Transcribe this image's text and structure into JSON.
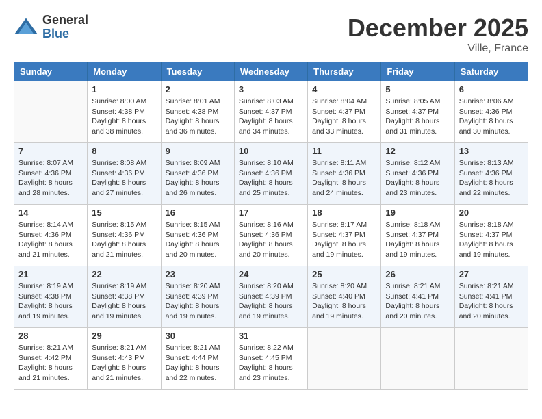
{
  "header": {
    "logo_general": "General",
    "logo_blue": "Blue",
    "month": "December 2025",
    "location": "Ville, France"
  },
  "days_of_week": [
    "Sunday",
    "Monday",
    "Tuesday",
    "Wednesday",
    "Thursday",
    "Friday",
    "Saturday"
  ],
  "weeks": [
    [
      {
        "day": "",
        "info": ""
      },
      {
        "day": "1",
        "info": "Sunrise: 8:00 AM\nSunset: 4:38 PM\nDaylight: 8 hours\nand 38 minutes."
      },
      {
        "day": "2",
        "info": "Sunrise: 8:01 AM\nSunset: 4:38 PM\nDaylight: 8 hours\nand 36 minutes."
      },
      {
        "day": "3",
        "info": "Sunrise: 8:03 AM\nSunset: 4:37 PM\nDaylight: 8 hours\nand 34 minutes."
      },
      {
        "day": "4",
        "info": "Sunrise: 8:04 AM\nSunset: 4:37 PM\nDaylight: 8 hours\nand 33 minutes."
      },
      {
        "day": "5",
        "info": "Sunrise: 8:05 AM\nSunset: 4:37 PM\nDaylight: 8 hours\nand 31 minutes."
      },
      {
        "day": "6",
        "info": "Sunrise: 8:06 AM\nSunset: 4:36 PM\nDaylight: 8 hours\nand 30 minutes."
      }
    ],
    [
      {
        "day": "7",
        "info": "Sunrise: 8:07 AM\nSunset: 4:36 PM\nDaylight: 8 hours\nand 28 minutes."
      },
      {
        "day": "8",
        "info": "Sunrise: 8:08 AM\nSunset: 4:36 PM\nDaylight: 8 hours\nand 27 minutes."
      },
      {
        "day": "9",
        "info": "Sunrise: 8:09 AM\nSunset: 4:36 PM\nDaylight: 8 hours\nand 26 minutes."
      },
      {
        "day": "10",
        "info": "Sunrise: 8:10 AM\nSunset: 4:36 PM\nDaylight: 8 hours\nand 25 minutes."
      },
      {
        "day": "11",
        "info": "Sunrise: 8:11 AM\nSunset: 4:36 PM\nDaylight: 8 hours\nand 24 minutes."
      },
      {
        "day": "12",
        "info": "Sunrise: 8:12 AM\nSunset: 4:36 PM\nDaylight: 8 hours\nand 23 minutes."
      },
      {
        "day": "13",
        "info": "Sunrise: 8:13 AM\nSunset: 4:36 PM\nDaylight: 8 hours\nand 22 minutes."
      }
    ],
    [
      {
        "day": "14",
        "info": "Sunrise: 8:14 AM\nSunset: 4:36 PM\nDaylight: 8 hours\nand 21 minutes."
      },
      {
        "day": "15",
        "info": "Sunrise: 8:15 AM\nSunset: 4:36 PM\nDaylight: 8 hours\nand 21 minutes."
      },
      {
        "day": "16",
        "info": "Sunrise: 8:15 AM\nSunset: 4:36 PM\nDaylight: 8 hours\nand 20 minutes."
      },
      {
        "day": "17",
        "info": "Sunrise: 8:16 AM\nSunset: 4:36 PM\nDaylight: 8 hours\nand 20 minutes."
      },
      {
        "day": "18",
        "info": "Sunrise: 8:17 AM\nSunset: 4:37 PM\nDaylight: 8 hours\nand 19 minutes."
      },
      {
        "day": "19",
        "info": "Sunrise: 8:18 AM\nSunset: 4:37 PM\nDaylight: 8 hours\nand 19 minutes."
      },
      {
        "day": "20",
        "info": "Sunrise: 8:18 AM\nSunset: 4:37 PM\nDaylight: 8 hours\nand 19 minutes."
      }
    ],
    [
      {
        "day": "21",
        "info": "Sunrise: 8:19 AM\nSunset: 4:38 PM\nDaylight: 8 hours\nand 19 minutes."
      },
      {
        "day": "22",
        "info": "Sunrise: 8:19 AM\nSunset: 4:38 PM\nDaylight: 8 hours\nand 19 minutes."
      },
      {
        "day": "23",
        "info": "Sunrise: 8:20 AM\nSunset: 4:39 PM\nDaylight: 8 hours\nand 19 minutes."
      },
      {
        "day": "24",
        "info": "Sunrise: 8:20 AM\nSunset: 4:39 PM\nDaylight: 8 hours\nand 19 minutes."
      },
      {
        "day": "25",
        "info": "Sunrise: 8:20 AM\nSunset: 4:40 PM\nDaylight: 8 hours\nand 19 minutes."
      },
      {
        "day": "26",
        "info": "Sunrise: 8:21 AM\nSunset: 4:41 PM\nDaylight: 8 hours\nand 20 minutes."
      },
      {
        "day": "27",
        "info": "Sunrise: 8:21 AM\nSunset: 4:41 PM\nDaylight: 8 hours\nand 20 minutes."
      }
    ],
    [
      {
        "day": "28",
        "info": "Sunrise: 8:21 AM\nSunset: 4:42 PM\nDaylight: 8 hours\nand 21 minutes."
      },
      {
        "day": "29",
        "info": "Sunrise: 8:21 AM\nSunset: 4:43 PM\nDaylight: 8 hours\nand 21 minutes."
      },
      {
        "day": "30",
        "info": "Sunrise: 8:21 AM\nSunset: 4:44 PM\nDaylight: 8 hours\nand 22 minutes."
      },
      {
        "day": "31",
        "info": "Sunrise: 8:22 AM\nSunset: 4:45 PM\nDaylight: 8 hours\nand 23 minutes."
      },
      {
        "day": "",
        "info": ""
      },
      {
        "day": "",
        "info": ""
      },
      {
        "day": "",
        "info": ""
      }
    ]
  ]
}
